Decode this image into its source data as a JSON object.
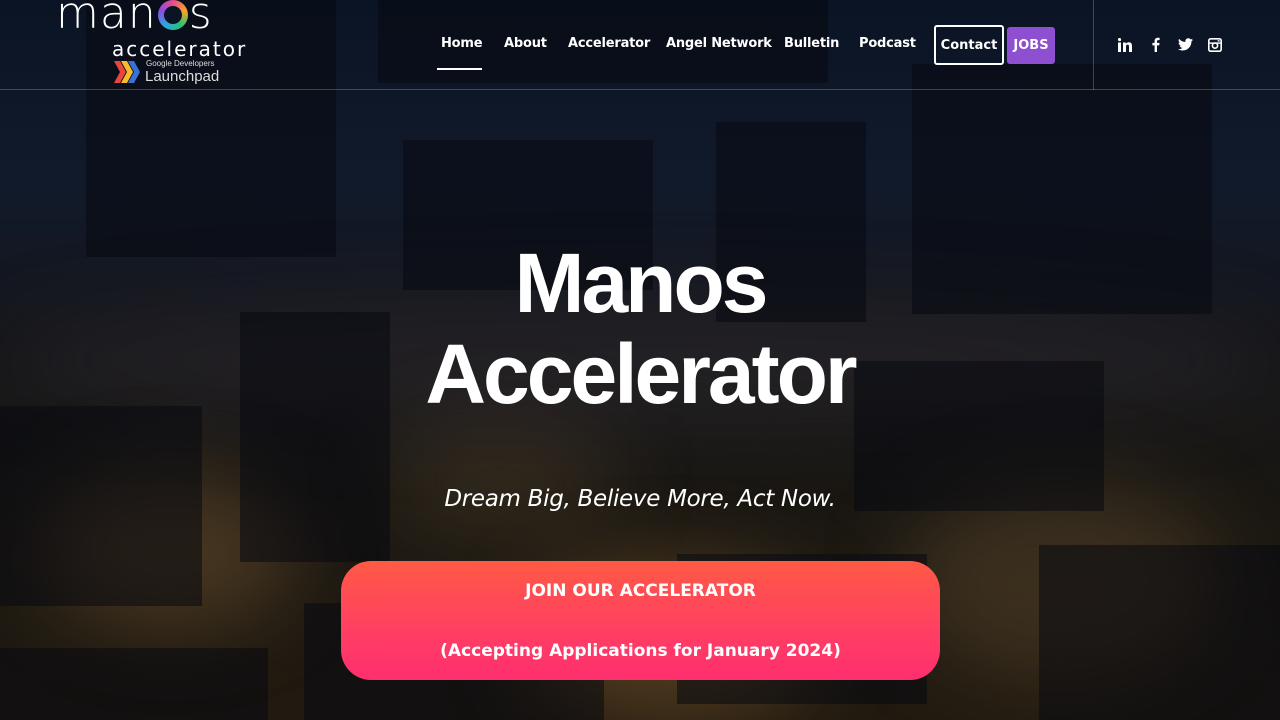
{
  "logo": {
    "wordmark_pre": "man",
    "wordmark_post": "s",
    "subtitle": "accelerator",
    "launchpad_small": "Google Developers",
    "launchpad_big": "Launchpad"
  },
  "nav": {
    "items": [
      {
        "label": "Home",
        "active": true
      },
      {
        "label": "About"
      },
      {
        "label": "Accelerator"
      },
      {
        "label": "Angel Network"
      },
      {
        "label": "Bulletin"
      },
      {
        "label": "Podcast"
      }
    ],
    "contact_label": "Contact",
    "jobs_label": "JOBS"
  },
  "social": {
    "icons": [
      "linkedin-icon",
      "facebook-icon",
      "twitter-icon",
      "instagram-icon"
    ],
    "linkedin_text": "in",
    "facebook_text": "f"
  },
  "hero": {
    "title_line1": "Manos",
    "title_line2": "Accelerator",
    "tagline": "Dream Big, Believe More, Act Now.",
    "cta_line1": "JOIN OUR ACCELERATOR",
    "cta_line2": "(Accepting Applications for January 2024)"
  },
  "colors": {
    "jobs_bg": "#8e4fd1",
    "cta_top": "#ff5a45",
    "cta_bottom": "#ff2f6e"
  }
}
